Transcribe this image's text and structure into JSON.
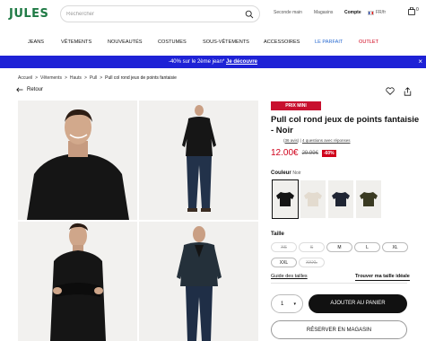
{
  "header": {
    "logo": "JULES",
    "search_placeholder": "Rechercher",
    "links": {
      "occasion": "Seconde main",
      "magasins": "Magasins",
      "compte": "Compte",
      "lang": "FR/fr"
    },
    "cart_count": "0"
  },
  "nav": [
    "JEANS",
    "VÊTEMENTS",
    "NOUVEAUTÉS",
    "COSTUMES",
    "SOUS-VÊTEMENTS",
    "ACCESSOIRES",
    "LE PARFAIT",
    "OUTLET"
  ],
  "nav_colors": {
    "le_parfait": "#2a6bd1",
    "outlet": "#d0021b"
  },
  "promo": {
    "text": "-40% sur le 2ème jean* ",
    "link": "Je découvre",
    "bg": "#1e22d6"
  },
  "breadcrumb": [
    "Accueil",
    "Vêtements",
    "Hauts",
    "Pull",
    "Pull col rond jeux de points fantaisie"
  ],
  "back_label": "Retour",
  "product": {
    "badge": "PRIX MINI",
    "title": "Pull col rond jeux de points fantaisie - Noir",
    "reviews_count": "36 avis",
    "questions": "4 questions avec réponses",
    "price_now": "12.00€",
    "price_old": "29.99€",
    "discount": "-60%",
    "color_label": "Couleur",
    "color_value": "Noir",
    "swatches": [
      "#141414",
      "#e8e1d6",
      "#1f2533",
      "#3a3a22"
    ],
    "size_label": "Taille",
    "sizes": [
      {
        "label": "XS",
        "available": false
      },
      {
        "label": "S",
        "available": false
      },
      {
        "label": "M",
        "available": true
      },
      {
        "label": "L",
        "available": true
      },
      {
        "label": "XL",
        "available": true
      },
      {
        "label": "XXL",
        "available": true
      },
      {
        "label": "XXXL",
        "available": false
      }
    ],
    "guide_label": "Guide des tailles",
    "find_size_label": "Trouver ma taille idéale",
    "quantity": "1",
    "add_to_cart": "AJOUTER AU PANIER",
    "reserve": "RÉSERVER EN MAGASIN"
  }
}
